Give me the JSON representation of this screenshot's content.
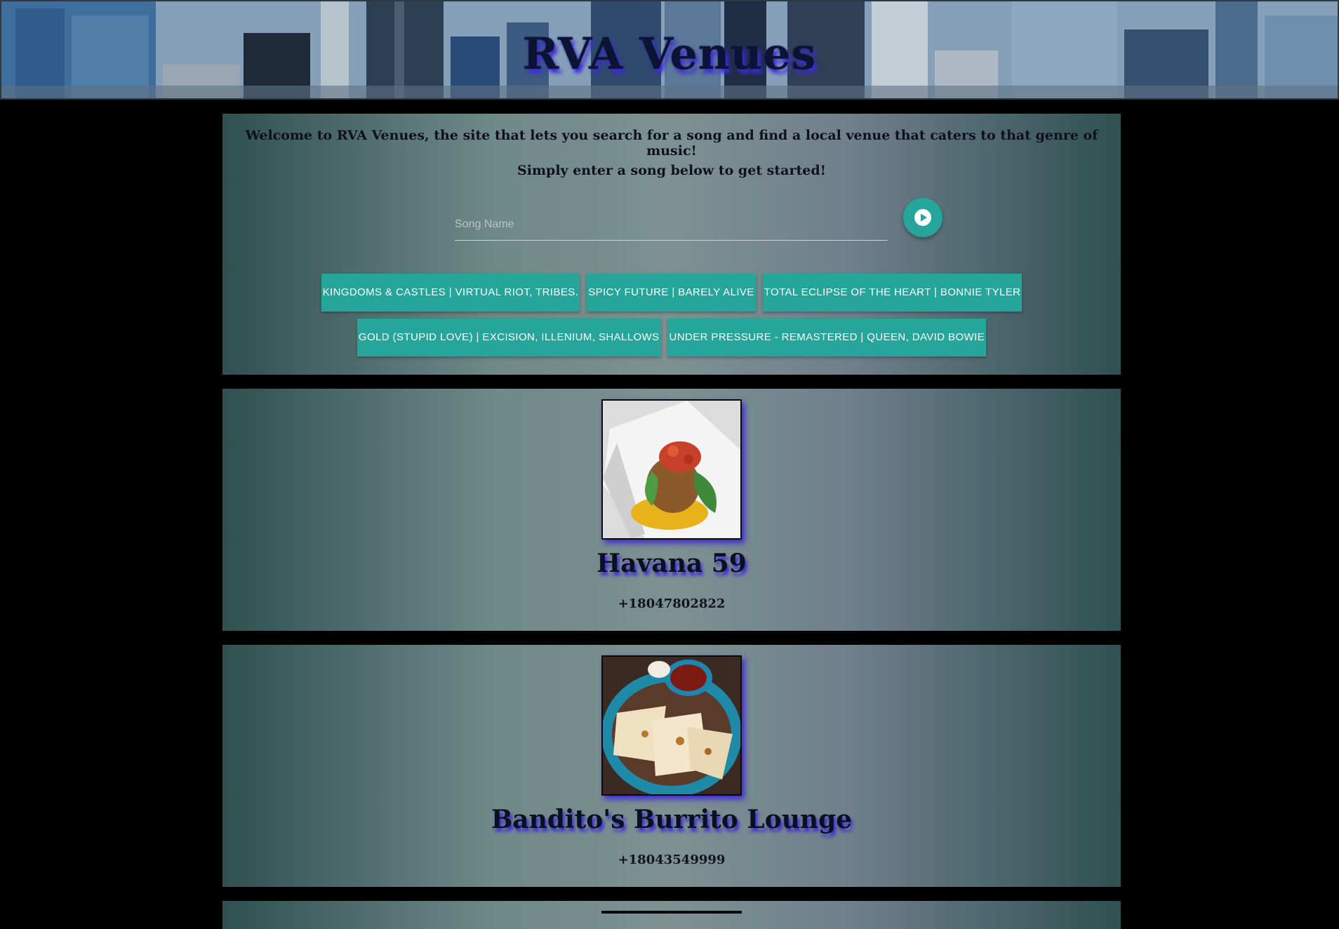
{
  "header": {
    "title": "RVA Venues"
  },
  "intro": {
    "welcome": "Welcome to RVA Venues, the site that lets you search for a song and find a local venue that caters to that genre of music!",
    "instructions": "Simply enter a song below to get started!"
  },
  "search": {
    "placeholder": "Song Name",
    "value": "",
    "button_icon": "play-circle-icon"
  },
  "suggestions": [
    "KINGDOMS & CASTLES | VIRTUAL RIOT, TRIBES.",
    "SPICY FUTURE | BARELY ALIVE",
    "TOTAL ECLIPSE OF THE HEART | BONNIE TYLER",
    "GOLD (STUPID LOVE) | EXCISION, ILLENIUM, SHALLOWS",
    "UNDER PRESSURE - REMASTERED | QUEEN, DAVID BOWIE"
  ],
  "venues": [
    {
      "name": "Havana 59",
      "phone": "+18047802822",
      "photo": "plated-dish-photo"
    },
    {
      "name": "Bandito's Burrito Lounge",
      "phone": "+18043549999",
      "photo": "quesadilla-photo"
    }
  ],
  "colors": {
    "accent": "#26a69a",
    "title_shadow": "#3c2bd6",
    "background": "#000000"
  }
}
